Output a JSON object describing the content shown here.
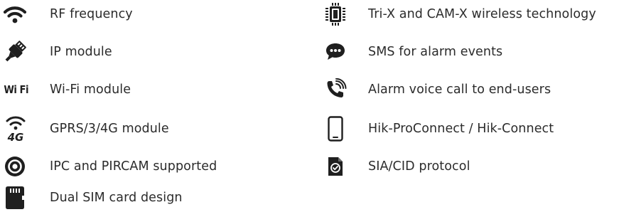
{
  "features": {
    "left": [
      {
        "icon": "wifi-signal-icon",
        "label": "RF frequency"
      },
      {
        "icon": "ethernet-plug-icon",
        "label": "IP module"
      },
      {
        "icon": "wifi-text-logo-icon",
        "icon_text": "Wi Fi",
        "label": "Wi-Fi module"
      },
      {
        "icon": "4g-signal-icon",
        "icon_text": "4G",
        "label": "GPRS/3/4G module"
      },
      {
        "icon": "camera-lens-icon",
        "label": "IPC and PIRCAM supported"
      },
      {
        "icon": "sim-card-icon",
        "label": "Dual SIM card design"
      }
    ],
    "right": [
      {
        "icon": "chip-icon",
        "label": "Tri-X and CAM-X wireless technology"
      },
      {
        "icon": "chat-bubble-icon",
        "label": "SMS for alarm events"
      },
      {
        "icon": "phone-call-icon",
        "label": "Alarm voice call to end-users"
      },
      {
        "icon": "smartphone-icon",
        "label": "Hik-ProConnect / Hik-Connect"
      },
      {
        "icon": "document-check-icon",
        "label": "SIA/CID protocol"
      }
    ]
  },
  "colors": {
    "text": "#2b2b2b",
    "icon": "#1f1f1f"
  }
}
